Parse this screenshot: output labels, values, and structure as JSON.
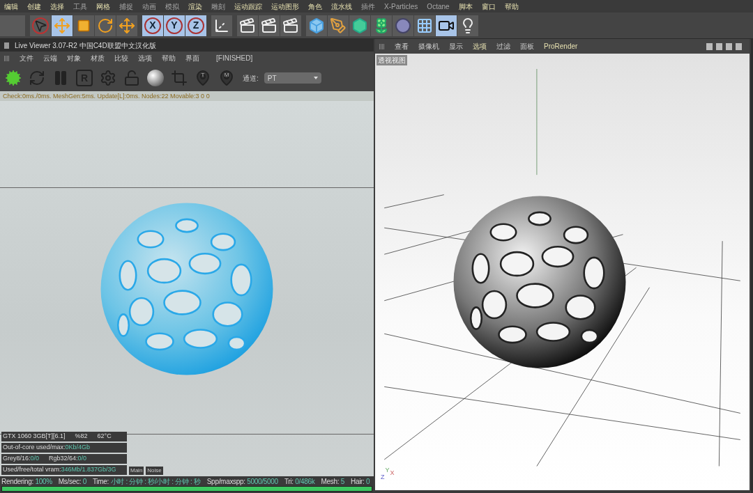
{
  "menu_bar": [
    {
      "label": "编辑",
      "dimmed": false
    },
    {
      "label": "创建",
      "dimmed": false
    },
    {
      "label": "选择",
      "dimmed": false
    },
    {
      "label": "工具",
      "dimmed": true
    },
    {
      "label": "网格",
      "dimmed": false
    },
    {
      "label": "捕捉",
      "dimmed": true
    },
    {
      "label": "动画",
      "dimmed": true
    },
    {
      "label": "模拟",
      "dimmed": true
    },
    {
      "label": "渲染",
      "dimmed": false
    },
    {
      "label": "雕刻",
      "dimmed": true
    },
    {
      "label": "运动跟踪",
      "dimmed": false
    },
    {
      "label": "运动图形",
      "dimmed": false
    },
    {
      "label": "角色",
      "dimmed": false
    },
    {
      "label": "流水线",
      "dimmed": false
    },
    {
      "label": "插件",
      "dimmed": true
    },
    {
      "label": "X-Particles",
      "dimmed": true
    },
    {
      "label": "Octane",
      "dimmed": true
    },
    {
      "label": "脚本",
      "dimmed": false
    },
    {
      "label": "窗口",
      "dimmed": false
    },
    {
      "label": "帮助",
      "dimmed": false
    }
  ],
  "toolbar": [
    {
      "kind": "blank",
      "selected": false
    },
    {
      "kind": "select",
      "selected": false
    },
    {
      "kind": "move",
      "selected": true
    },
    {
      "kind": "scale",
      "selected": false
    },
    {
      "kind": "rotate",
      "selected": false
    },
    {
      "kind": "move",
      "selected": false
    },
    {
      "kind": "axis",
      "label": "X",
      "selected": true
    },
    {
      "kind": "axis",
      "label": "Y",
      "selected": true
    },
    {
      "kind": "axis",
      "label": "Z",
      "selected": true
    },
    {
      "kind": "coords",
      "selected": false
    },
    {
      "kind": "render",
      "selected": false
    },
    {
      "kind": "render",
      "selected": false
    },
    {
      "kind": "render",
      "selected": false
    },
    {
      "kind": "cube",
      "selected": false
    },
    {
      "kind": "pen",
      "selected": false
    },
    {
      "kind": "subdivide",
      "selected": false
    },
    {
      "kind": "cloner",
      "selected": false
    },
    {
      "kind": "deformer",
      "selected": false
    },
    {
      "kind": "floor",
      "selected": false
    },
    {
      "kind": "camera",
      "selected": true
    },
    {
      "kind": "light",
      "selected": false
    }
  ],
  "live_viewer": {
    "title": "Live Viewer 3.07-R2 中国C4D联盟中文汉化版",
    "menu": [
      "文件",
      "云端",
      "对象",
      "材质",
      "比较",
      "选项",
      "帮助",
      "界面"
    ],
    "state": "[FINISHED]",
    "tools": [
      {
        "kind": "octane"
      },
      {
        "kind": "refresh"
      },
      {
        "kind": "pause"
      },
      {
        "kind": "letter",
        "label": "R"
      },
      {
        "kind": "gear"
      },
      {
        "kind": "lock"
      },
      {
        "kind": "ball"
      },
      {
        "kind": "region"
      },
      {
        "kind": "pin",
        "label": "T"
      },
      {
        "kind": "pin",
        "label": "M"
      }
    ],
    "channel_label": "通道:",
    "channel_value": "PT",
    "info_line": "Check:0ms./0ms. MeshGen:5ms. Update[L]:0ms. Nodes:22 Movable:3  0 0",
    "stats": [
      [
        {
          "label": "GTX 1060 3GB[T][6.1]"
        },
        {
          "label": "%82"
        },
        {
          "label": "62°C"
        }
      ],
      [
        {
          "label": "Out-of-core used/max:",
          "value": "0Kb/4Gb"
        }
      ],
      [
        {
          "label": "Grey8/16:",
          "value": "0/0"
        },
        {
          "label": "Rgb32/64:",
          "value": "0/0"
        }
      ],
      [
        {
          "label": "Used/free/total vram:",
          "value": "346Mb/1.837Gb/3G"
        }
      ]
    ],
    "buffer_buttons": [
      {
        "label": "Main",
        "selected": false
      },
      {
        "label": "Noise",
        "selected": false
      }
    ],
    "status": [
      {
        "label": "Rendering:",
        "value": "100%"
      },
      {
        "label": "Ms/sec:",
        "value": "0"
      },
      {
        "label": "Time:",
        "value": "小时 : 分钟 : 秒/小时 : 分钟 : 秒"
      },
      {
        "label": "Spp/maxspp:",
        "value": "5000/5000"
      },
      {
        "label": "Tri:",
        "value": "0/486k"
      },
      {
        "label": "Mesh:",
        "value": "5"
      },
      {
        "label": "Hair:",
        "value": "0"
      }
    ],
    "progress": {
      "level": 1
    }
  },
  "viewport": {
    "menu": [
      {
        "label": "查看",
        "highlight": false
      },
      {
        "label": "摄像机",
        "highlight": false
      },
      {
        "label": "显示",
        "highlight": false
      },
      {
        "label": "选项",
        "highlight": true
      },
      {
        "label": "过滤",
        "highlight": false
      },
      {
        "label": "面板",
        "highlight": false
      },
      {
        "label": "ProRender",
        "highlight": true
      }
    ],
    "view_name": "透视视图",
    "axes": [
      "Z",
      "Y",
      "X"
    ]
  }
}
